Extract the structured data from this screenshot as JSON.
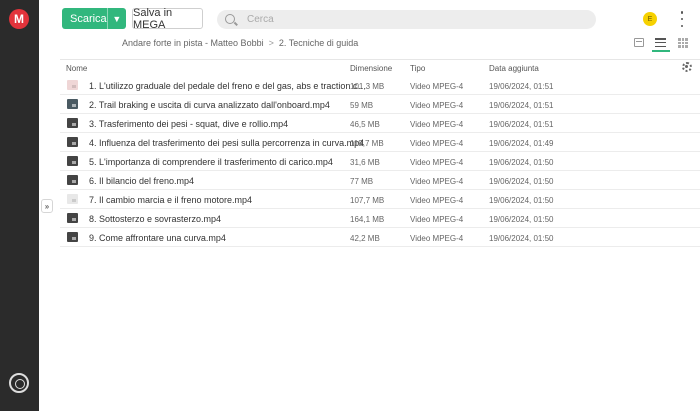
{
  "toolbar": {
    "download_label": "Scarica",
    "save_label": "Salva in MEGA"
  },
  "search": {
    "placeholder": "Cerca"
  },
  "avatar": {
    "initial": "E"
  },
  "breadcrumb": {
    "items": [
      "Andare forte in pista - Matteo Bobbi",
      "2. Tecniche di guida"
    ],
    "separator": ">"
  },
  "table": {
    "columns": {
      "name": "Nome",
      "size": "Dimensione",
      "type": "Tipo",
      "date": "Data aggiunta"
    },
    "rows": [
      {
        "name": "1. L'utilizzo graduale del pedale del freno e del gas, abs e traction control.mp4",
        "size": "101,3 MB",
        "type": "Video MPEG-4",
        "date": "19/06/2024, 01:51"
      },
      {
        "name": "2. Trail braking e uscita di curva analizzato dall'onboard.mp4",
        "size": "59 MB",
        "type": "Video MPEG-4",
        "date": "19/06/2024, 01:51"
      },
      {
        "name": "3. Trasferimento dei pesi - squat, dive e rollio.mp4",
        "size": "46,5 MB",
        "type": "Video MPEG-4",
        "date": "19/06/2024, 01:51"
      },
      {
        "name": "4. Influenza del trasferimento dei pesi sulla percorrenza in curva.mp4",
        "size": "119,7 MB",
        "type": "Video MPEG-4",
        "date": "19/06/2024, 01:49"
      },
      {
        "name": "5. L'importanza di comprendere il trasferimento di carico.mp4",
        "size": "31,6 MB",
        "type": "Video MPEG-4",
        "date": "19/06/2024, 01:50"
      },
      {
        "name": "6. Il bilancio del freno.mp4",
        "size": "77 MB",
        "type": "Video MPEG-4",
        "date": "19/06/2024, 01:50"
      },
      {
        "name": "7. Il cambio marcia e il freno motore.mp4",
        "size": "107,7 MB",
        "type": "Video MPEG-4",
        "date": "19/06/2024, 01:50"
      },
      {
        "name": "8. Sottosterzo e sovrasterzo.mp4",
        "size": "164,1 MB",
        "type": "Video MPEG-4",
        "date": "19/06/2024, 01:50"
      },
      {
        "name": "9. Come affrontare una curva.mp4",
        "size": "42,2 MB",
        "type": "Video MPEG-4",
        "date": "19/06/2024, 01:50"
      }
    ]
  },
  "colors": {
    "accent": "#31b77d",
    "sidebar": "#2b2b2b",
    "brand": "#e2333b"
  },
  "icons": [
    "mega-logo-icon",
    "sync-icon",
    "search-icon",
    "chevron-down-icon",
    "kebab-menu-icon",
    "thumbnail-view-icon",
    "list-view-icon",
    "grid-view-icon",
    "gear-icon",
    "expand-sidebar-icon"
  ]
}
